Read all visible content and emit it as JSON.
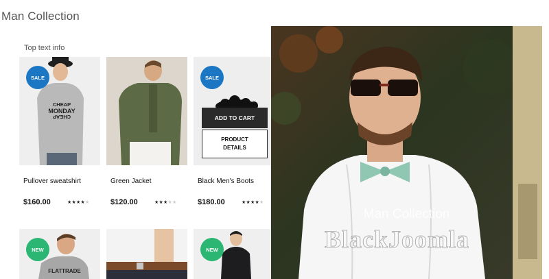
{
  "page": {
    "title": "Man Collection",
    "top_text": "Top text info"
  },
  "products": [
    {
      "name": "Pullover sweatshirt",
      "price": "$160.00",
      "rating": 4,
      "badge": "SALE"
    },
    {
      "name": "Green Jacket",
      "price": "$120.00",
      "rating": 3,
      "badge": ""
    },
    {
      "name": "Black Men's Boots",
      "price": "$180.00",
      "rating": 4,
      "badge": "SALE",
      "hover_actions": {
        "add_to_cart": "ADD TO CART",
        "details_line1": "PRODUCT",
        "details_line2": "DETAILS"
      }
    },
    {
      "badge": "NEW"
    },
    {
      "badge": ""
    },
    {
      "badge": "NEW"
    }
  ],
  "shirt_print": [
    "CHEAP",
    "MONDAY",
    "CHEAP"
  ],
  "second_row_print": "FLATTRADE",
  "hero": {
    "caption": "Man Collection",
    "watermark": "BlackJoomla"
  },
  "colors": {
    "sale_badge": "#1b76c4",
    "new_badge": "#2bb673",
    "button_dark": "#2a2a2a"
  },
  "rating_max": 5
}
